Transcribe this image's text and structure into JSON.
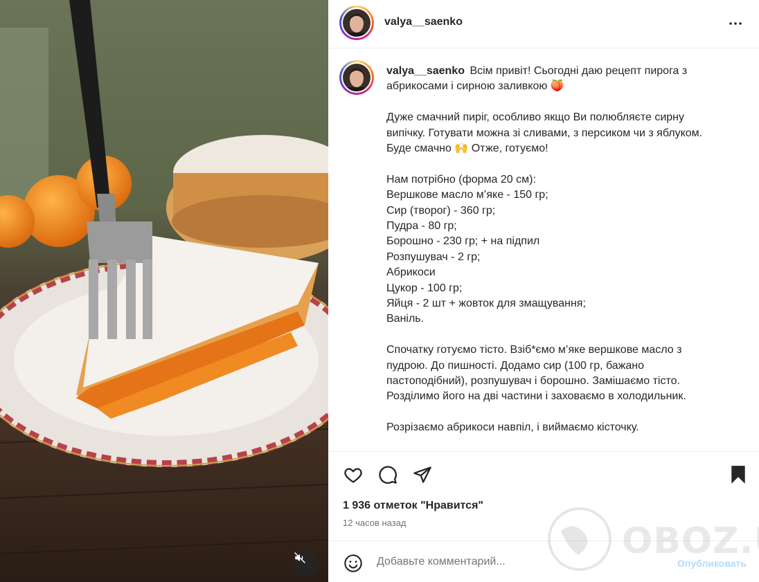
{
  "post": {
    "author": "valya__saenko",
    "caption_lines": [
      "Всім привіт! Сьогодні даю рецепт пирога з абрикосами і сирною заливкою 🍑"
    ],
    "paragraph_2": [
      "Дуже смачний пиріг, особливо якщо Ви полюбляєте сирну",
      "випічку. Готувати можна зі сливами, з персиком чи з яблуком.",
      "Буде смачно 🙌  Отже, готуємо!"
    ],
    "ingredients": [
      "Нам потрібно (форма 20 см):",
      "Вершкове масло м’яке - 150 гр;",
      "Сир (творог) - 360 гр;",
      "Пудра - 80 гр;",
      "Борошно - 230 гр; + на підпил",
      "Розпушувач - 2 гр;",
      "Абрикоси",
      "Цукор - 100 гр;",
      "Яйця - 2 шт + жовток для змащування;",
      "Ваніль."
    ],
    "steps": [
      "Спочатку готуємо тісто. Взіб*ємо м’яке вершкове масло з",
      "пудрою. До пишності. Додамо сир (100 гр, бажано",
      "пастоподібний), розпушувач і борошно. Замішаємо тісто.",
      "Розділимо його на дві частини і заховаємо в холодильник."
    ],
    "last_line": "Розрізаємо абрикоси навпіл, і виймаємо кісточку.",
    "likes": "1 936 отметок \"Нравится\"",
    "time_ago": "12 часов назад"
  },
  "comment": {
    "placeholder": "Добавьте комментарий...",
    "publish_label": "Опубликовать"
  },
  "watermark": "OBOZ.UA",
  "icons": {
    "more": "more-horizontal-icon",
    "like": "heart-icon",
    "comment": "comment-icon",
    "share": "send-icon",
    "save": "bookmark-icon",
    "emoji": "emoji-icon",
    "mute": "speaker-muted-icon"
  },
  "colors": {
    "text": "#262626",
    "secondary": "#737373",
    "publish_disabled": "#b3dbff",
    "divider": "#efefef"
  }
}
